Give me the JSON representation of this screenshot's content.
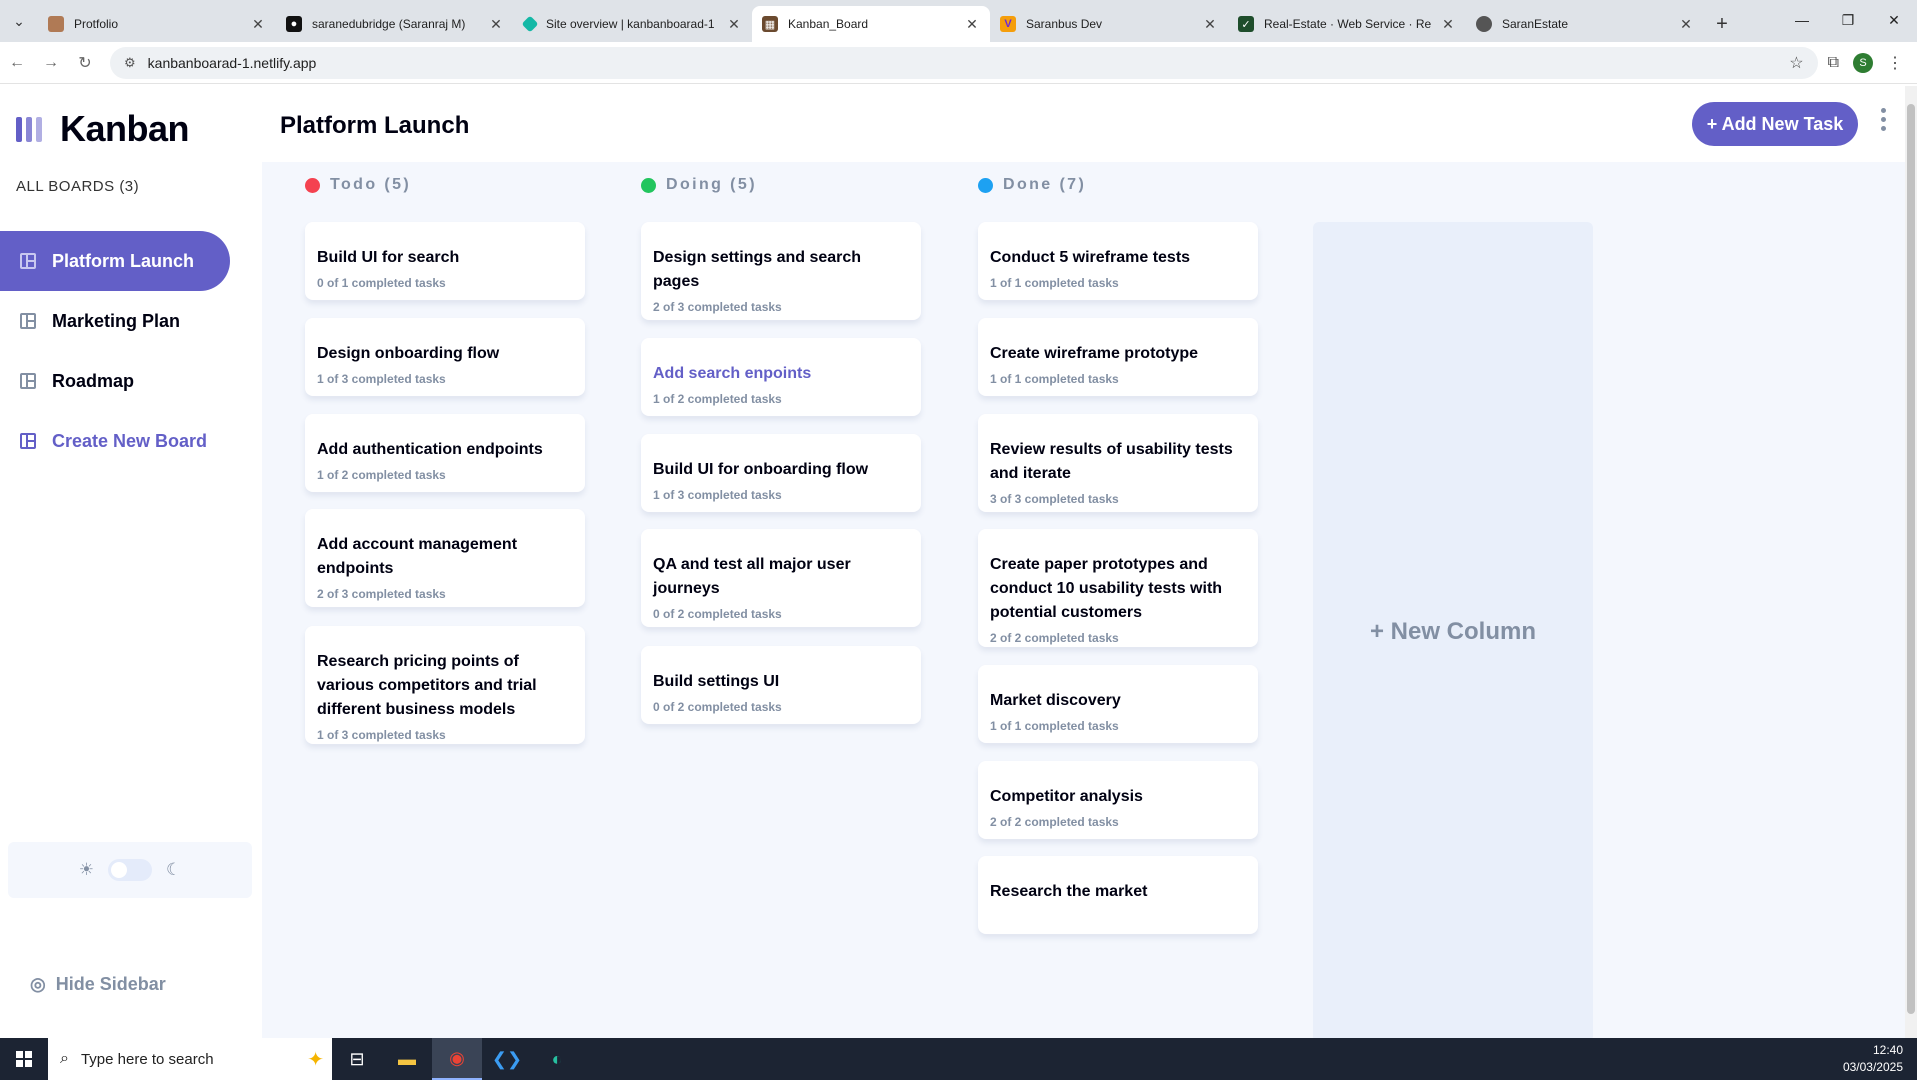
{
  "browser": {
    "tabs": [
      {
        "title": "Protfolio",
        "active": false
      },
      {
        "title": "saranedubridge (Saranraj M)",
        "active": false
      },
      {
        "title": "Site overview | kanbanboarad-1",
        "active": false
      },
      {
        "title": "Kanban_Board",
        "active": true
      },
      {
        "title": "Saranbus Dev",
        "active": false
      },
      {
        "title": "Real-Estate · Web Service · Re",
        "active": false
      },
      {
        "title": "SaranEstate",
        "active": false
      }
    ],
    "url": "kanbanboarad-1.netlify.app",
    "profile_initial": "S"
  },
  "app": {
    "logo": "Kanban",
    "boards_label": "ALL BOARDS (3)",
    "boards": [
      {
        "label": "Platform Launch",
        "active": true
      },
      {
        "label": "Marketing Plan",
        "active": false
      },
      {
        "label": "Roadmap",
        "active": false
      }
    ],
    "create_board": "Create New Board",
    "hide_sidebar": "Hide Sidebar",
    "board_title": "Platform Launch",
    "add_task": "+ Add New Task",
    "new_column": "+ New Column",
    "columns": [
      {
        "header": "Todo (5)",
        "color": "#f44250",
        "cards": [
          {
            "title": "Build UI for search",
            "subtasks": "0 of 1 completed tasks"
          },
          {
            "title": "Design onboarding flow",
            "subtasks": "1 of 3 completed tasks"
          },
          {
            "title": "Add authentication endpoints",
            "subtasks": "1 of 2 completed tasks"
          },
          {
            "title": "Add account management endpoints",
            "subtasks": "2 of 3 completed tasks"
          },
          {
            "title": "Research pricing points of various competitors and trial different business models",
            "subtasks": "1 of 3 completed tasks"
          }
        ]
      },
      {
        "header": "Doing (5)",
        "color": "#22c55e",
        "cards": [
          {
            "title": "Design settings and search pages",
            "subtasks": "2 of 3 completed tasks"
          },
          {
            "title": "Add search enpoints",
            "subtasks": "1 of 2 completed tasks"
          },
          {
            "title": "Build UI for onboarding flow",
            "subtasks": "1 of 3 completed tasks"
          },
          {
            "title": "QA and test all major user journeys",
            "subtasks": "0 of 2 completed tasks"
          },
          {
            "title": "Build settings UI",
            "subtasks": "0 of 2 completed tasks"
          }
        ]
      },
      {
        "header": "Done (7)",
        "color": "#1da1f2",
        "cards": [
          {
            "title": "Conduct 5 wireframe tests",
            "subtasks": "1 of 1 completed tasks"
          },
          {
            "title": "Create wireframe prototype",
            "subtasks": "1 of 1 completed tasks"
          },
          {
            "title": "Review results of usability tests and iterate",
            "subtasks": "3 of 3 completed tasks"
          },
          {
            "title": "Create paper prototypes and conduct 10 usability tests with potential customers",
            "subtasks": "2 of 2 completed tasks"
          },
          {
            "title": "Market discovery",
            "subtasks": "1 of 1 completed tasks"
          },
          {
            "title": "Competitor analysis",
            "subtasks": "2 of 2 completed tasks"
          },
          {
            "title": "Research the market",
            "subtasks": ""
          }
        ]
      }
    ]
  },
  "taskbar": {
    "search_placeholder": "Type here to search",
    "time": "12:40",
    "date": "03/03/2025"
  }
}
